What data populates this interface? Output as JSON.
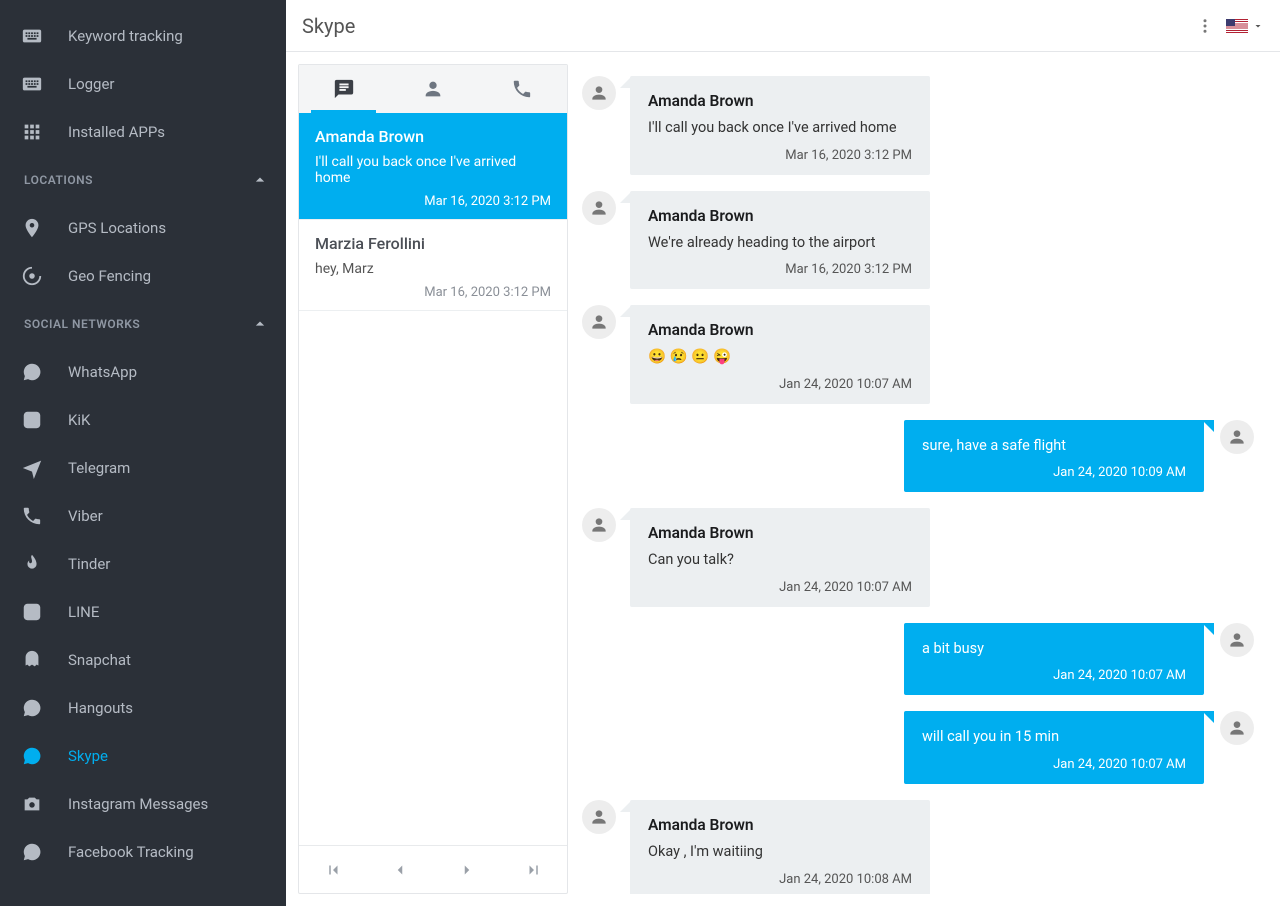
{
  "header": {
    "title": "Skype"
  },
  "sidebar": {
    "top": [
      {
        "id": "keyword-tracking",
        "label": "Keyword tracking",
        "icon": "keyboard-icon"
      },
      {
        "id": "logger",
        "label": "Logger",
        "icon": "keyboard-icon"
      },
      {
        "id": "installed-apps",
        "label": "Installed APPs",
        "icon": "apps-icon"
      }
    ],
    "sections": [
      {
        "id": "locations",
        "label": "LOCATIONS",
        "items": [
          {
            "id": "gps-locations",
            "label": "GPS Locations",
            "icon": "pin-icon"
          },
          {
            "id": "geo-fencing",
            "label": "Geo Fencing",
            "icon": "radar-icon"
          }
        ]
      },
      {
        "id": "social-networks",
        "label": "SOCIAL NETWORKS",
        "items": [
          {
            "id": "whatsapp",
            "label": "WhatsApp",
            "icon": "whatsapp-icon"
          },
          {
            "id": "kik",
            "label": "KiK",
            "icon": "kik-icon"
          },
          {
            "id": "telegram",
            "label": "Telegram",
            "icon": "telegram-icon"
          },
          {
            "id": "viber",
            "label": "Viber",
            "icon": "viber-icon"
          },
          {
            "id": "tinder",
            "label": "Tinder",
            "icon": "flame-icon"
          },
          {
            "id": "line",
            "label": "LINE",
            "icon": "line-icon"
          },
          {
            "id": "snapchat",
            "label": "Snapchat",
            "icon": "snapchat-icon"
          },
          {
            "id": "hangouts",
            "label": "Hangouts",
            "icon": "hangouts-icon"
          },
          {
            "id": "skype",
            "label": "Skype",
            "icon": "skype-icon",
            "active": true
          },
          {
            "id": "instagram",
            "label": "Instagram Messages",
            "icon": "instagram-icon"
          },
          {
            "id": "facebook",
            "label": "Facebook Tracking",
            "icon": "facebook-icon"
          }
        ]
      }
    ]
  },
  "conversations": [
    {
      "name": "Amanda Brown",
      "preview": "I'll call you back once I've arrived home",
      "time": "Mar 16, 2020 3:12 PM",
      "active": true
    },
    {
      "name": "Marzia Ferollini",
      "preview": "hey, Marz",
      "time": "Mar 16, 2020 3:12 PM",
      "active": false
    }
  ],
  "messages": [
    {
      "dir": "in",
      "sender": "Amanda Brown",
      "text": "I'll call you back once I've arrived home",
      "time": "Mar 16, 2020 3:12 PM"
    },
    {
      "dir": "in",
      "sender": "Amanda Brown",
      "text": "We're already heading to the airport",
      "time": "Mar 16, 2020 3:12 PM"
    },
    {
      "dir": "in",
      "sender": "Amanda Brown",
      "text": "😀 😢 😐 😜",
      "time": "Jan 24, 2020 10:07 AM"
    },
    {
      "dir": "out",
      "sender": "",
      "text": "sure, have a safe flight",
      "time": "Jan 24, 2020 10:09 AM"
    },
    {
      "dir": "in",
      "sender": "Amanda Brown",
      "text": "Can you talk?",
      "time": "Jan 24, 2020 10:07 AM"
    },
    {
      "dir": "out",
      "sender": "",
      "text": "a bit busy",
      "time": "Jan 24, 2020 10:07 AM"
    },
    {
      "dir": "out",
      "sender": "",
      "text": "will call you in 15 min",
      "time": "Jan 24, 2020 10:07 AM"
    },
    {
      "dir": "in",
      "sender": "Amanda Brown",
      "text": "Okay , I'm waitiing",
      "time": "Jan 24, 2020 10:08 AM"
    }
  ]
}
